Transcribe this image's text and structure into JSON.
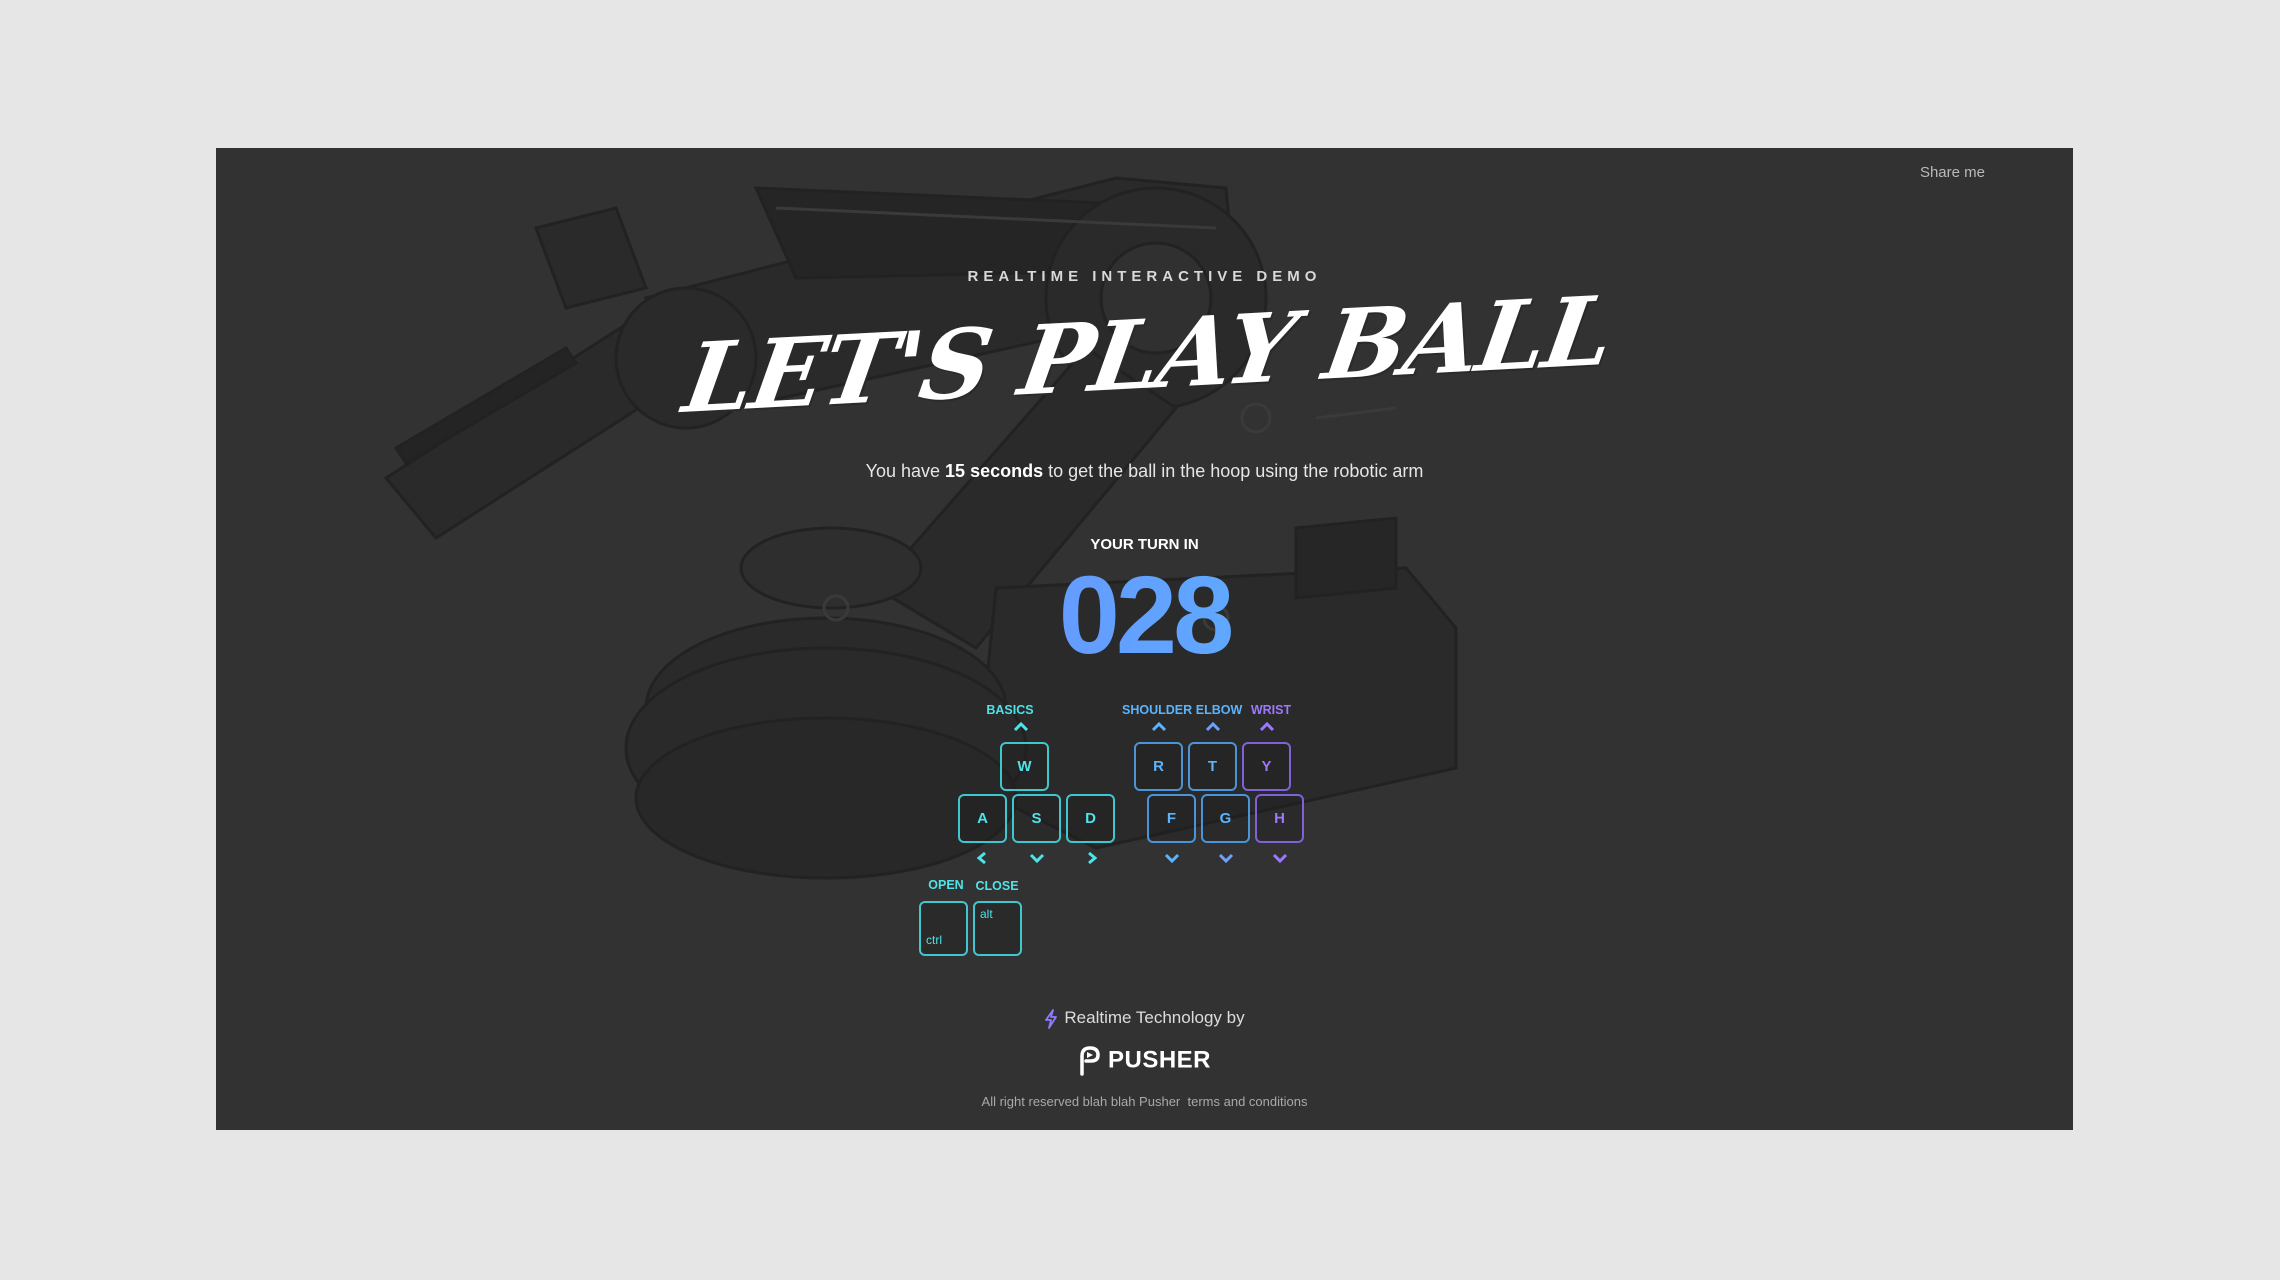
{
  "header": {
    "share_label": "Share me"
  },
  "hero": {
    "eyebrow": "REALTIME INTERACTIVE DEMO",
    "title": "LET'S PLAY BALL",
    "sub_prefix": "You have ",
    "sub_bold": "15 seconds",
    "sub_suffix": " to get the ball in the hoop using the robotic arm"
  },
  "turn": {
    "label": "YOUR TURN IN",
    "countdown": "028"
  },
  "controls": {
    "basics_label": "BASICS",
    "shoulder_label": "SHOULDER",
    "elbow_label": "ELBOW",
    "wrist_label": "WRIST",
    "open_label": "OPEN",
    "close_label": "CLOSE",
    "keys": {
      "w": "W",
      "a": "A",
      "s": "S",
      "d": "D",
      "r": "R",
      "t": "T",
      "y": "Y",
      "f": "F",
      "g": "G",
      "h": "H",
      "ctrl": "ctrl",
      "alt": "alt"
    }
  },
  "footer": {
    "tech_label": "Realtime Technology by",
    "brand": "PUSHER",
    "copyright": "All right reserved blah blah Pusher",
    "terms_link": "terms and conditions"
  },
  "colors": {
    "background": "#323232",
    "page": "#e6e6e6",
    "cyan": "#4de3e8",
    "blue": "#5ab4ff",
    "purple": "#9b78ff"
  },
  "icons": {
    "bolt": "lightning-bolt-icon",
    "logo": "pusher-logo-icon",
    "up": "chevron-up-icon",
    "down": "chevron-down-icon",
    "left": "chevron-left-icon",
    "right": "chevron-right-icon"
  }
}
